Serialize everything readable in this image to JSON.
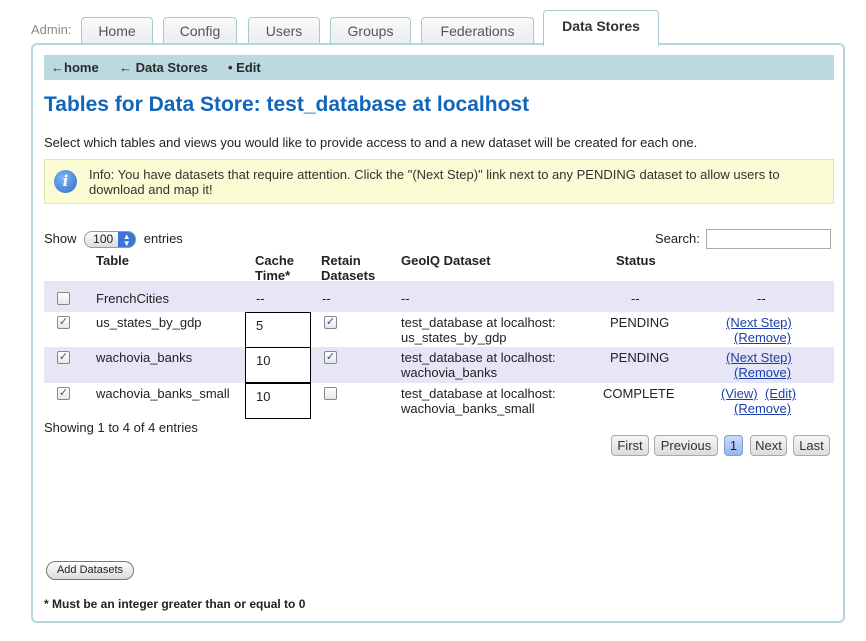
{
  "admin_label": "Admin:",
  "tabs": [
    {
      "label": "Home",
      "active": false
    },
    {
      "label": "Config",
      "active": false
    },
    {
      "label": "Users",
      "active": false
    },
    {
      "label": "Groups",
      "active": false
    },
    {
      "label": "Federations",
      "active": false
    },
    {
      "label": "Data Stores",
      "active": true
    }
  ],
  "breadcrumb": {
    "home": "←home",
    "data_stores": "← Data Stores",
    "edit": "• Edit"
  },
  "page_title": "Tables for Data Store: test_database at localhost",
  "description": "Select which tables and views you would like to provide access to and a new dataset will be created for each one.",
  "info_message": "Info:  You have datasets that require attention. Click the \"(Next Step)\" link next to any PENDING dataset to allow users to download and map it!",
  "show": {
    "prefix": "Show",
    "value": "100",
    "suffix": "entries"
  },
  "search": {
    "label": "Search:",
    "value": ""
  },
  "columns": {
    "table": "Table",
    "cache_time_1": "Cache",
    "cache_time_2": "Time*",
    "retain_1": "Retain",
    "retain_2": "Datasets",
    "dataset": "GeoIQ Dataset",
    "status": "Status"
  },
  "rows": [
    {
      "checked": false,
      "table": "FrenchCities",
      "cache": "--",
      "retain": "--",
      "dataset_1": "--",
      "dataset_2": "",
      "status": "--",
      "actions": "--"
    },
    {
      "checked": true,
      "table": "us_states_by_gdp",
      "cache": "5",
      "retain": true,
      "dataset_1": "test_database at localhost:",
      "dataset_2": "us_states_by_gdp",
      "status": "PENDING",
      "action_1": "(Next Step)",
      "action_2": "(Remove)"
    },
    {
      "checked": true,
      "table": "wachovia_banks",
      "cache": "10",
      "retain": true,
      "dataset_1": "test_database at localhost:",
      "dataset_2": "wachovia_banks",
      "status": "PENDING",
      "action_1": "(Next Step)",
      "action_2": "(Remove)"
    },
    {
      "checked": true,
      "table": "wachovia_banks_small",
      "cache": "10",
      "retain": false,
      "dataset_1": "test_database at localhost:",
      "dataset_2": "wachovia_banks_small",
      "status": "COMPLETE",
      "action_view": "(View)",
      "action_edit": "(Edit)",
      "action_2": "(Remove)"
    }
  ],
  "showing_text": "Showing 1 to 4 of 4 entries",
  "pager": {
    "first": "First",
    "previous": "Previous",
    "current": "1",
    "next": "Next",
    "last": "Last"
  },
  "add_button": "Add Datasets",
  "footnote": "* Must be an integer greater than or equal to 0",
  "icons": {
    "info": "info-icon",
    "select_arrow": "updown-arrow-icon"
  },
  "colors": {
    "title": "#1166bb",
    "navbar": "#bcd9e0",
    "info_bg": "#fbfbd4",
    "row_alt": "#e6e6f6",
    "link": "#1d3fa8"
  }
}
